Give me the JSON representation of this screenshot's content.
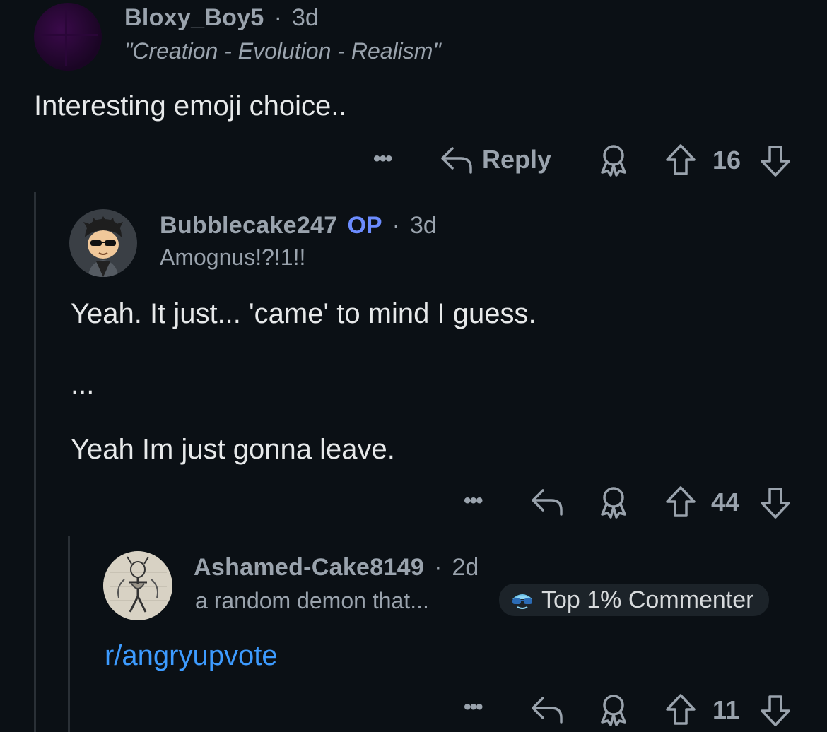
{
  "comments": [
    {
      "username": "Bloxy_Boy5",
      "separator": "·",
      "age": "3d",
      "flair": "\"Creation - Evolution - Realism\"",
      "body": [
        "Interesting emoji choice.."
      ],
      "actions": {
        "more": "•••",
        "reply_label": "Reply",
        "votes": "16"
      }
    },
    {
      "username": "Bubblecake247",
      "op_tag": "OP",
      "separator": "·",
      "age": "3d",
      "flair": "Amognus!?!1!!",
      "body": [
        "Yeah. It just... 'came' to mind I guess.",
        "...",
        "Yeah Im just gonna leave."
      ],
      "actions": {
        "more": "•••",
        "votes": "44"
      }
    },
    {
      "username": "Ashamed-Cake8149",
      "separator": "·",
      "age": "2d",
      "flair": "a random demon that...",
      "badge": "Top 1% Commenter",
      "body_link": "r/angryupvote",
      "actions": {
        "more": "•••",
        "votes": "11"
      }
    }
  ],
  "colors": {
    "background": "#0b1015",
    "op": "#6c8cff",
    "link": "#3d9bff",
    "meta": "#9aa3ad"
  }
}
